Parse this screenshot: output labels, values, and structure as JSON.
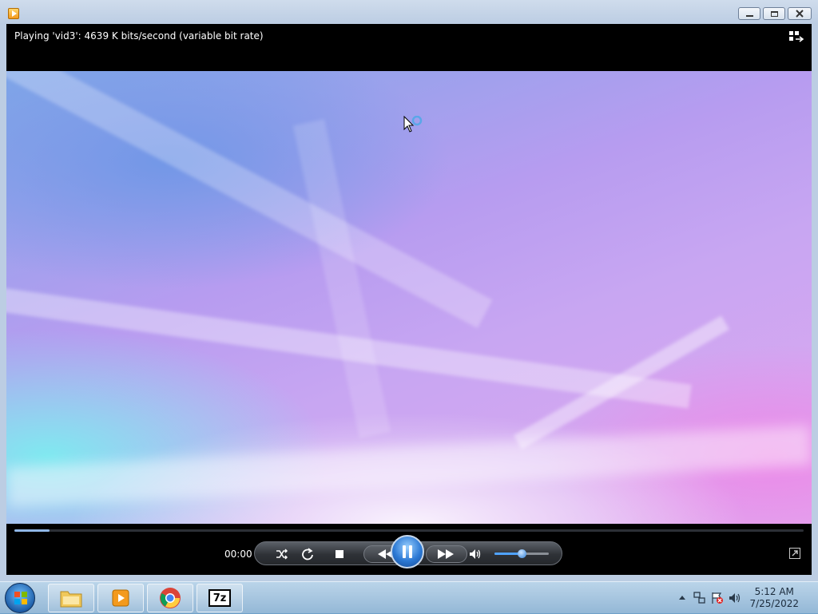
{
  "window": {
    "status_text": "Playing 'vid3': 4639 K bits/second (variable bit rate)",
    "icons": [
      "media-player-app-icon",
      "minimize-icon",
      "maximize-icon",
      "close-icon",
      "switch-to-library-icon"
    ]
  },
  "player": {
    "elapsed_time": "00:00",
    "seek_progress": 0.045,
    "volume_level": 0.5,
    "controls": [
      "shuffle",
      "repeat",
      "stop",
      "previous",
      "pause",
      "next",
      "mute"
    ]
  },
  "taskbar": {
    "apps": [
      "windows-explorer",
      "windows-media-player",
      "google-chrome",
      "7-zip"
    ],
    "seven_zip_label": "7z",
    "clock_time": "5:12 AM",
    "clock_date": "7/25/2022",
    "tray_icons": [
      "show-hidden-icons",
      "network-icon",
      "action-center-icon",
      "volume-icon"
    ]
  },
  "colors": {
    "accent": "#2c79d4",
    "player_bg": "#000000",
    "seek_fill": "#8fb6e6"
  }
}
